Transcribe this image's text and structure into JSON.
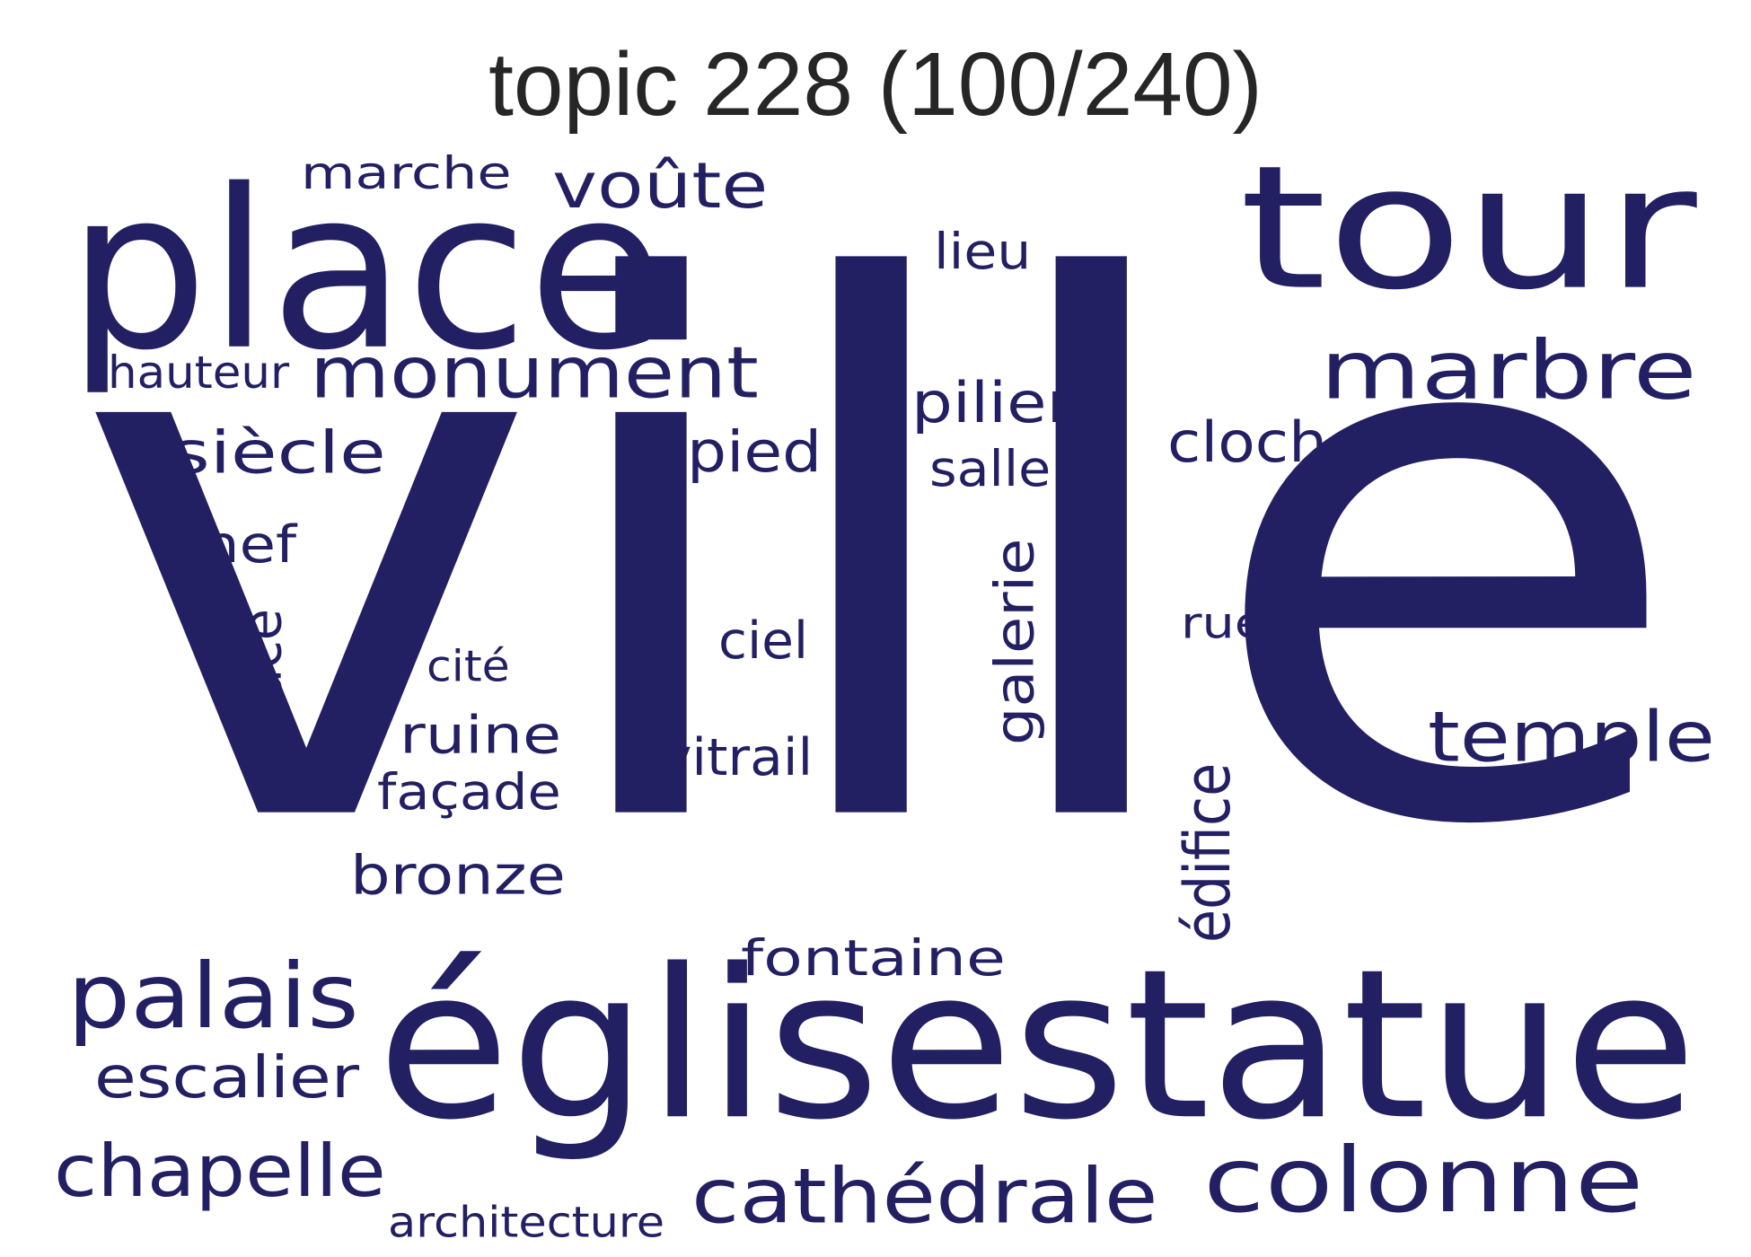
{
  "title": "topic 228 (100/240)",
  "text_color": "#221f63",
  "title_color": "#262626",
  "words": [
    {
      "text": "ville",
      "vertical": false
    },
    {
      "text": "églisestatue",
      "vertical": false
    },
    {
      "text": "tour",
      "vertical": false
    },
    {
      "text": "place",
      "vertical": false
    },
    {
      "text": "marbre",
      "vertical": false
    },
    {
      "text": "colonne",
      "vertical": false
    },
    {
      "text": "cathédrale",
      "vertical": false
    },
    {
      "text": "monument",
      "vertical": false
    },
    {
      "text": "palais",
      "vertical": false
    },
    {
      "text": "chapelle",
      "vertical": false
    },
    {
      "text": "temple",
      "vertical": false
    },
    {
      "text": "siècle",
      "vertical": false
    },
    {
      "text": "voûte",
      "vertical": false
    },
    {
      "text": "escalier",
      "vertical": false
    },
    {
      "text": "bronze",
      "vertical": false
    },
    {
      "text": "cloche",
      "vertical": false
    },
    {
      "text": "pied",
      "vertical": false
    },
    {
      "text": "pilier",
      "vertical": false
    },
    {
      "text": "ruine",
      "vertical": false
    },
    {
      "text": "façade",
      "vertical": false
    },
    {
      "text": "marche",
      "vertical": false
    },
    {
      "text": "fontaine",
      "vertical": false
    },
    {
      "text": "vitrail",
      "vertical": false
    },
    {
      "text": "galerie",
      "vertical": true
    },
    {
      "text": "édifice",
      "vertical": true
    },
    {
      "text": "salle",
      "vertical": false
    },
    {
      "text": "ciel",
      "vertical": false
    },
    {
      "text": "nef",
      "vertical": false
    },
    {
      "text": "lieu",
      "vertical": false
    },
    {
      "text": "face",
      "vertical": true
    },
    {
      "text": "hauteur",
      "vertical": false
    },
    {
      "text": "rue",
      "vertical": false
    },
    {
      "text": "cité",
      "vertical": false
    },
    {
      "text": "architecture",
      "vertical": false
    }
  ]
}
